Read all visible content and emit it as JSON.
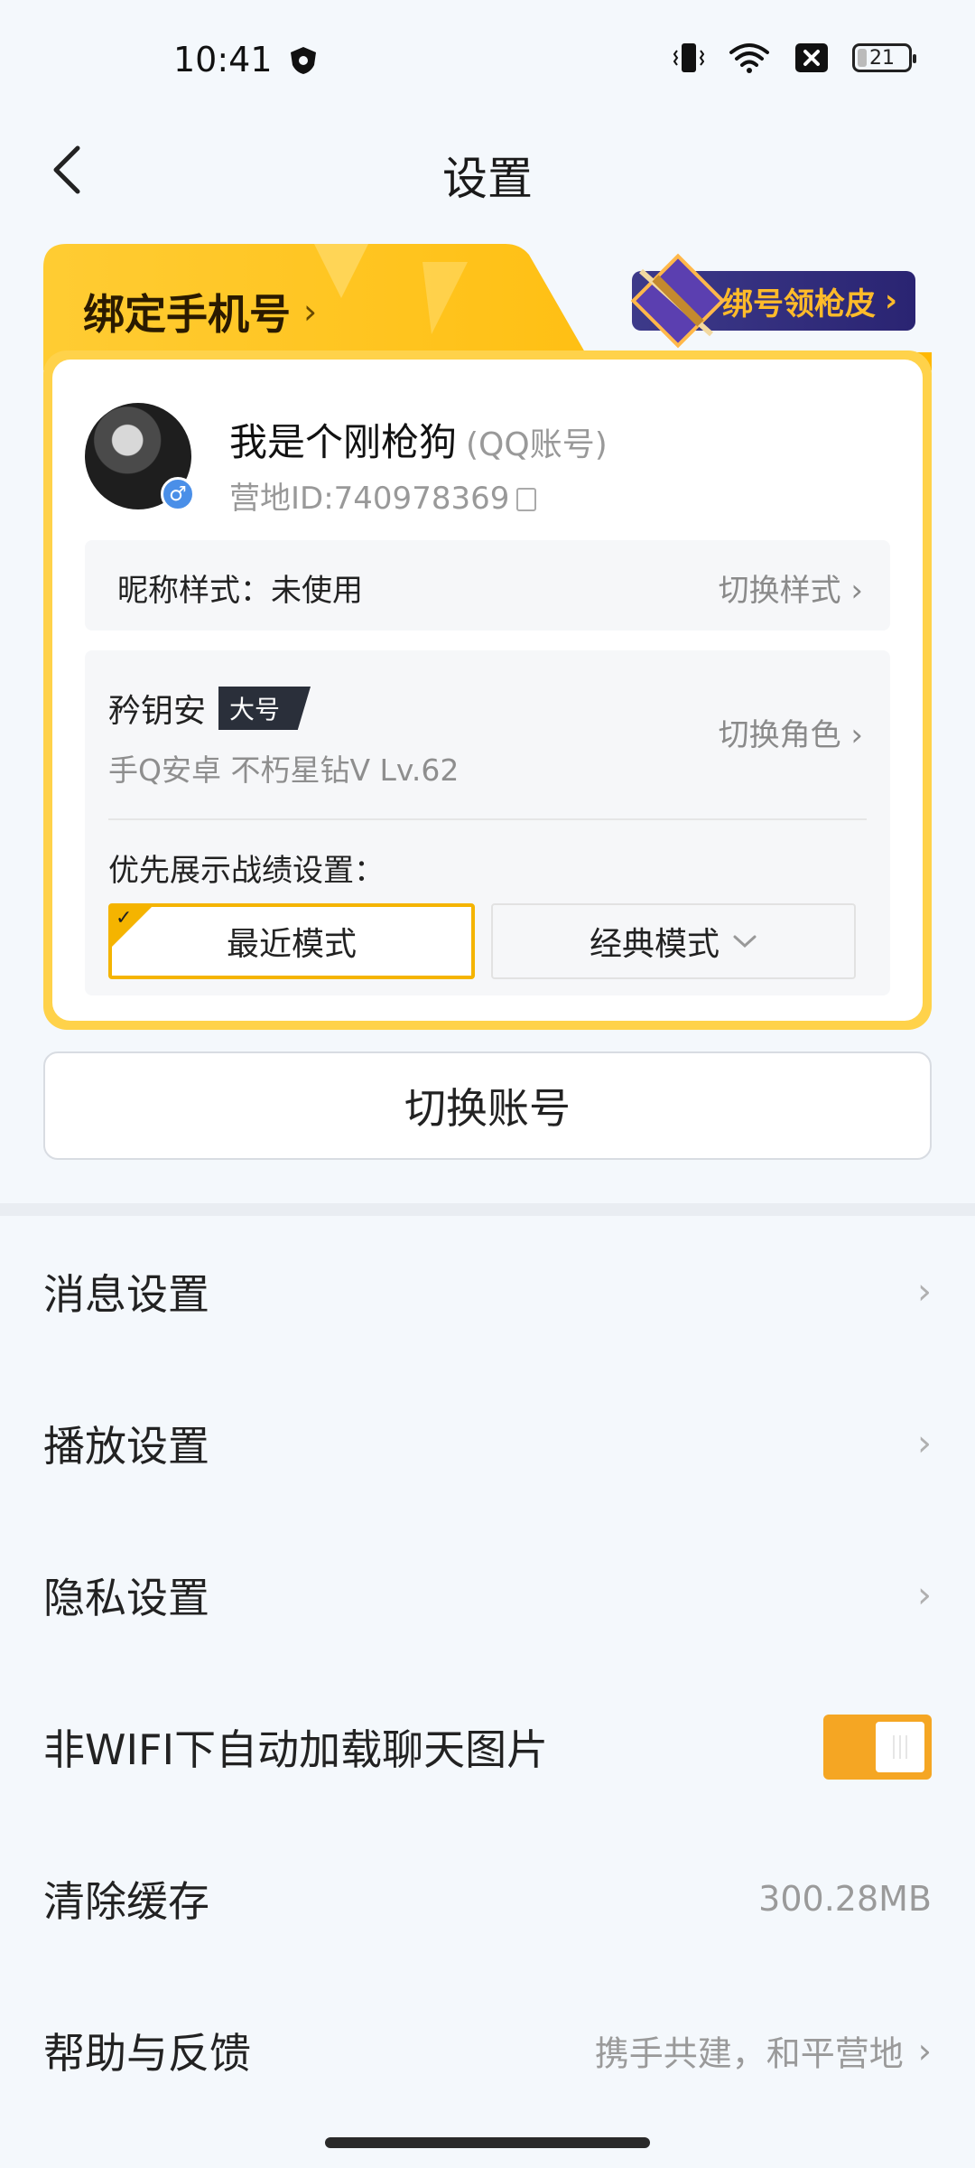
{
  "status_bar": {
    "time": "10:41",
    "battery_level": "21",
    "icons": [
      "shield-icon",
      "vibrate-icon",
      "wifi-icon",
      "sim-x-icon",
      "battery-icon"
    ]
  },
  "nav": {
    "title": "设置",
    "back_icon": "back-icon"
  },
  "account_card": {
    "bind_phone_label": "绑定手机号",
    "bind_phone_chevron": "›",
    "reward_label": "绑号领枪皮",
    "reward_chevron": "›",
    "nickname": "我是个刚枪狗",
    "account_type": "(QQ账号)",
    "camp_id": "营地ID:740978369",
    "gender_symbol": "♂",
    "nick_style_label": "昵称样式：未使用",
    "nick_style_action": "切换样式 ›",
    "role_name": "矜钥安",
    "role_tag": "大号",
    "role_detail": "手Q安卓  不朽星钻V  Lv.62",
    "role_action": "切换角色 ›",
    "priority_label": "优先展示战绩设置：",
    "mode_recent": "最近模式",
    "mode_classic": "经典模式",
    "mode_selected": "最近模式"
  },
  "switch_account_label": "切换账号",
  "settings": {
    "message": "消息设置",
    "playback": "播放设置",
    "privacy": "隐私设置",
    "auto_load": "非WIFI下自动加载聊天图片",
    "auto_load_enabled": true,
    "clear_cache": "清除缓存",
    "cache_size": "300.28MB",
    "help": "帮助与反馈",
    "help_value": "携手共建，和平营地",
    "chevron": "›"
  },
  "colors": {
    "accent_yellow": "#ffd24a",
    "toggle_orange": "#f5a623",
    "background": "#f4f8fc"
  }
}
